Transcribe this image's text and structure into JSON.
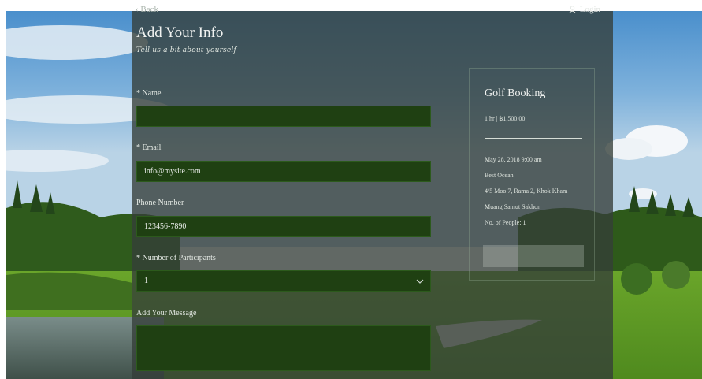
{
  "nav": {
    "back_label": "Back",
    "login_label": "Login"
  },
  "form": {
    "title": "Add Your Info",
    "subtitle": "Tell us a bit about yourself",
    "name_label": "* Name",
    "name_value": "",
    "email_label": "* Email",
    "email_value": "info@mysite.com",
    "phone_label": "Phone Number",
    "phone_value": "123456-7890",
    "participants_label": "* Number of Participants",
    "participants_value": "1",
    "message_label": "Add Your Message",
    "message_value": ""
  },
  "booking": {
    "title": "Golf Booking",
    "meta": "1 hr  |  ฿1,500.00",
    "date": "May 28, 2018 9:00 am",
    "staff": "Best Ocean",
    "address_line1": "4/5 Moo 7, Rama 2, Khok Kham",
    "address_line2": "Muang Samut Sakhon",
    "people": "No. of People: 1",
    "button_label": ""
  },
  "icons": {
    "back": "chevron-left-icon",
    "login": "user-icon",
    "dropdown": "chevron-down-icon"
  },
  "colors": {
    "field_bg": "#1f4012",
    "overlay": "rgba(52,62,56,0.78)"
  }
}
